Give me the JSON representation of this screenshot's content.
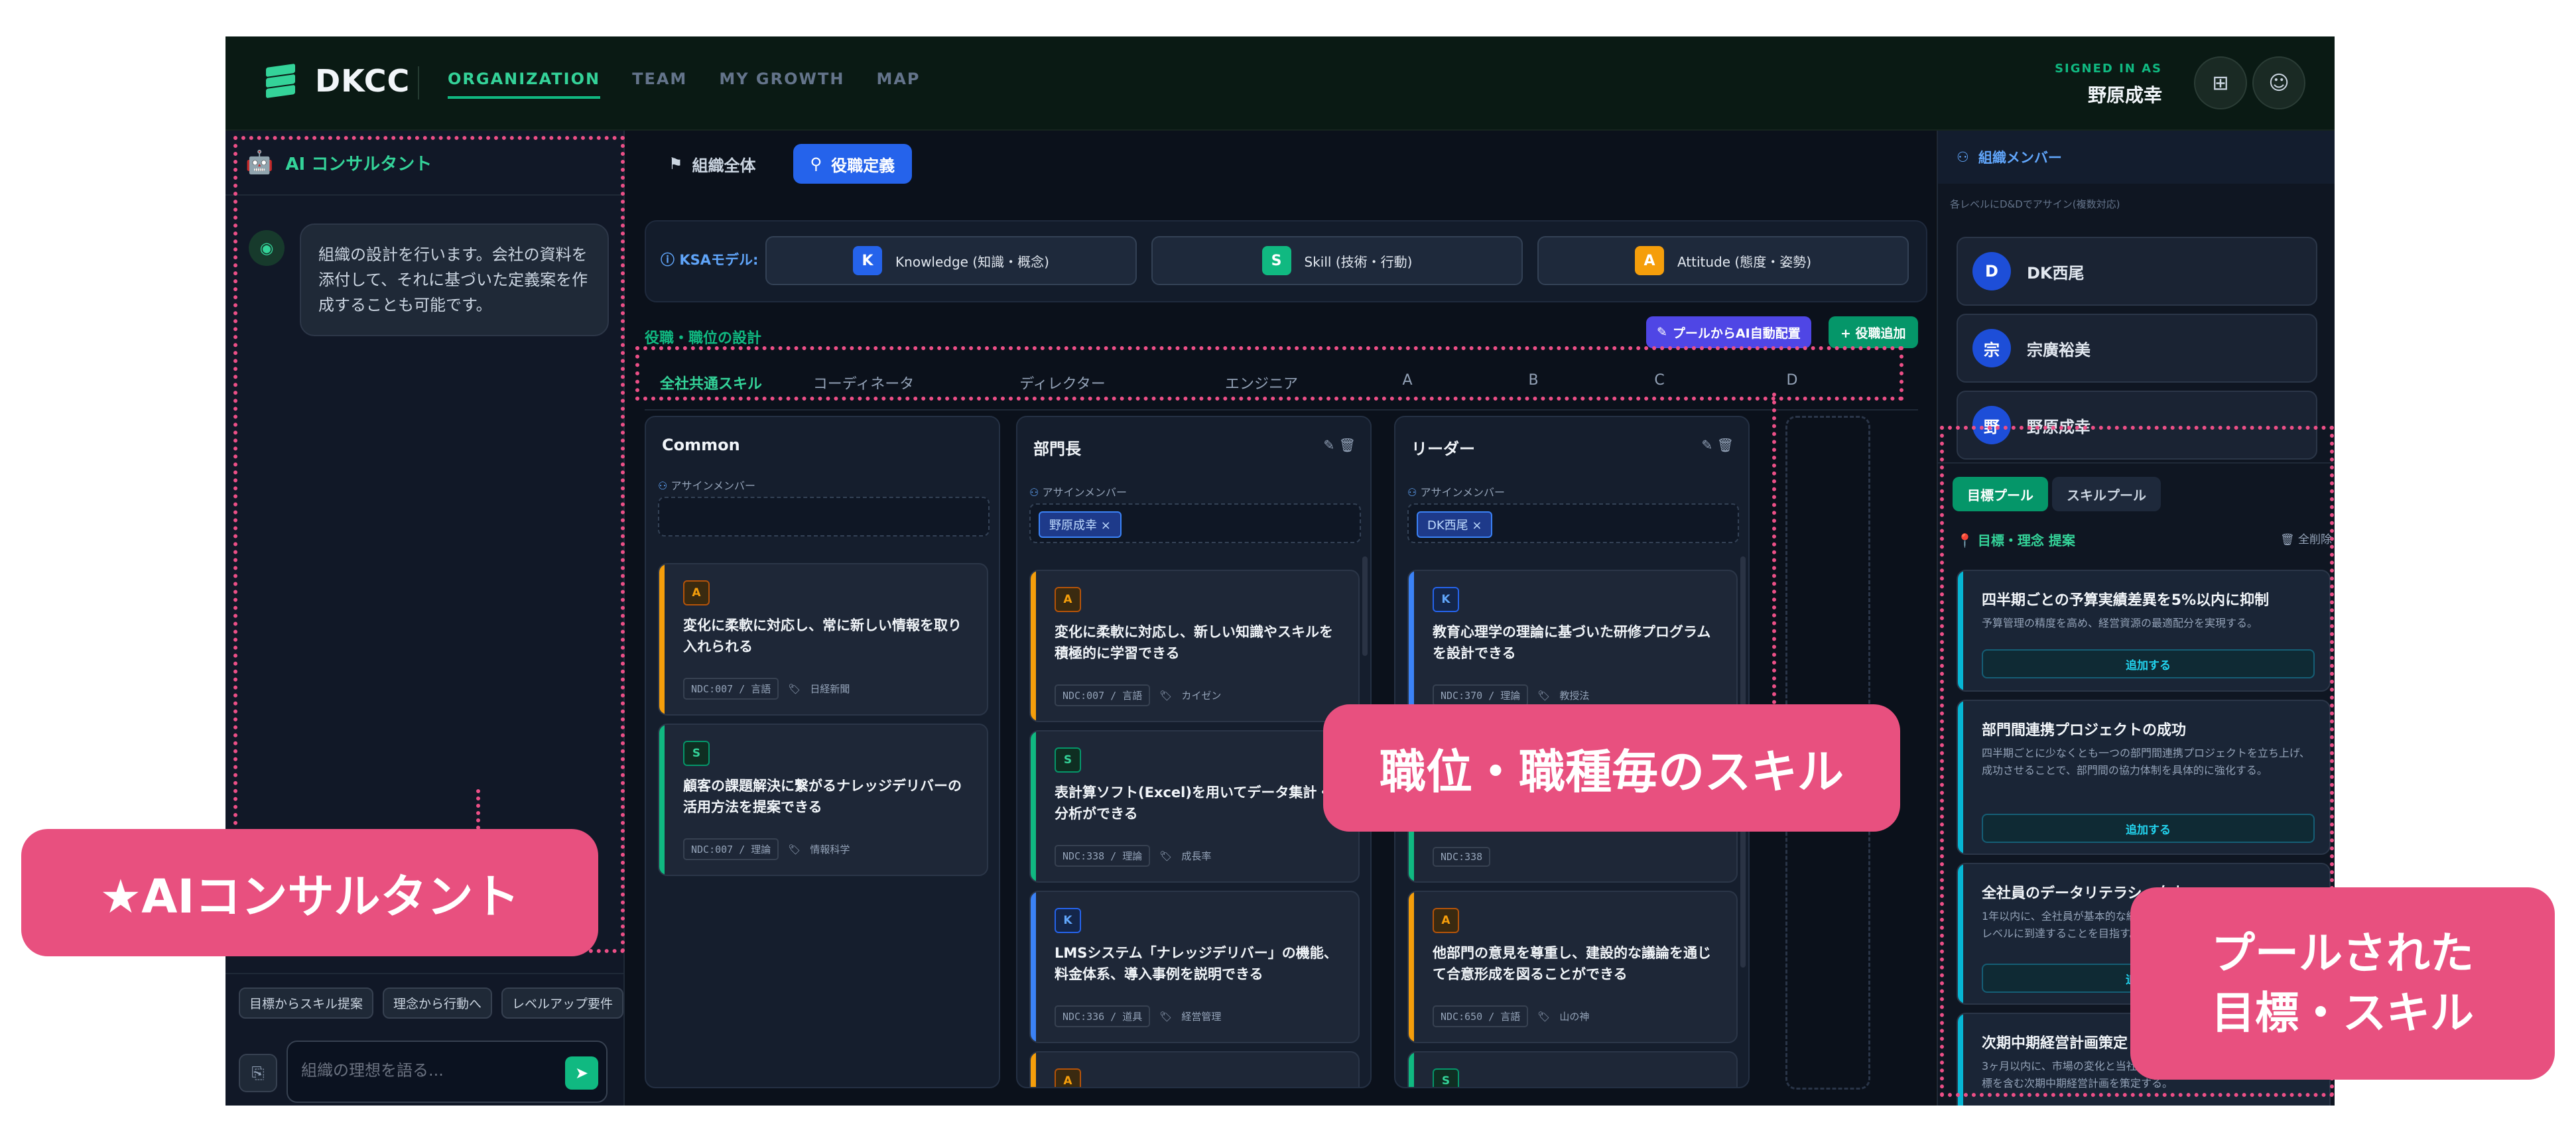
{
  "topbar": {
    "logo": "DKCC",
    "nav": [
      {
        "label": "ORGANIZATION",
        "active": true
      },
      {
        "label": "TEAM",
        "active": false
      },
      {
        "label": "MY GROWTH",
        "active": false
      },
      {
        "label": "MAP",
        "active": false
      }
    ],
    "signed_in_label": "SIGNED IN AS",
    "user_name": "野原成幸"
  },
  "chat": {
    "title": "AI コンサルタント",
    "message": "組織の設計を行います。会社の資料を添付して、それに基づいた定義案を作成することも可能です。",
    "chips": [
      "目標からスキル提案",
      "理念から行動へ",
      "レベルアップ要件"
    ],
    "input_placeholder": "組織の理想を語る..."
  },
  "center": {
    "tabs": [
      "組織全体",
      "役職定義"
    ],
    "ksa_label": "KSAモデル:",
    "ksa": [
      {
        "badge": "K",
        "label": "Knowledge (知識・概念)",
        "color": "#2563eb"
      },
      {
        "badge": "S",
        "label": "Skill (技術・行動)",
        "color": "#10b981"
      },
      {
        "badge": "A",
        "label": "Attitude (態度・姿勢)",
        "color": "#f59e0b"
      }
    ],
    "design_title": "役職・職位の設計",
    "auto_assign_button": "プールからAI自動配置",
    "add_role_button": "+ 役職追加",
    "role_tabs": [
      "全社共通スキル",
      "コーディネータ",
      "ディレクター",
      "エンジニア",
      "A",
      "B",
      "C",
      "D"
    ],
    "assign_label": "アサインメンバー",
    "columns": [
      {
        "title": "Common",
        "members": [],
        "cards": [
          {
            "type": "A",
            "text": "変化に柔軟に対応し、常に新しい情報を取り入れられる",
            "ndc": "NDC:007 / 言語",
            "src": "日経新聞"
          },
          {
            "type": "S",
            "text": "顧客の課題解決に繋がるナレッジデリバーの活用方法を提案できる",
            "ndc": "NDC:007 / 理論",
            "src": "情報科学"
          }
        ]
      },
      {
        "title": "部門長",
        "members": [
          "野原成幸 ×"
        ],
        "cards": [
          {
            "type": "A",
            "text": "変化に柔軟に対応し、新しい知識やスキルを積極的に学習できる",
            "ndc": "NDC:007 / 言語",
            "src": "カイゼン"
          },
          {
            "type": "S",
            "text": "表計算ソフト(Excel)を用いてデータ集計・分析ができる",
            "ndc": "NDC:338 / 理論",
            "src": "成長率"
          },
          {
            "type": "K",
            "text": "LMSシステム「ナレッジデリバー」の機能、料金体系、導入事例を説明できる",
            "ndc": "NDC:336 / 道具",
            "src": "経営管理"
          },
          {
            "type": "A",
            "text": "",
            "ndc": "",
            "src": ""
          }
        ]
      },
      {
        "title": "リーダー",
        "members": [
          "DK西尾 ×"
        ],
        "cards": [
          {
            "type": "K",
            "text": "教育心理学の理論に基づいた研修プログラムを設計できる",
            "ndc": "NDC:370 / 理論",
            "src": "教授法"
          },
          {
            "type": "S",
            "text": "",
            "ndc": "NDC:338",
            "src": ""
          },
          {
            "type": "A",
            "text": "他部門の意見を尊重し、建設的な議論を通じて合意形成を図ることができる",
            "ndc": "NDC:650 / 言語",
            "src": "山の神"
          },
          {
            "type": "S",
            "text": "",
            "ndc": "",
            "src": ""
          }
        ]
      }
    ]
  },
  "members": {
    "title": "組織メンバー",
    "subtitle": "各レベルにD&Dでアサイン(複数対応)",
    "list": [
      {
        "initial": "D",
        "name": "DK西尾"
      },
      {
        "initial": "宗",
        "name": "宗廣裕美"
      },
      {
        "initial": "野",
        "name": "野原成幸"
      }
    ]
  },
  "pool": {
    "tabs": [
      "目標プール",
      "スキルプール"
    ],
    "title": "目標・理念 提案",
    "all_label": "全削除",
    "add_label": "追加する",
    "goals": [
      {
        "title": "四半期ごとの予算実績差異を5%以内に抑制",
        "desc": "予算管理の精度を高め、経営資源の最適配分を実現する。"
      },
      {
        "title": "部門間連携プロジェクトの成功",
        "desc": "四半期ごとに少なくとも一つの部門間連携プロジェクトを立ち上げ、成功させることで、部門間の協力体制を具体的に強化する。"
      },
      {
        "title": "全社員のデータリテラシー向上",
        "desc": "1年以内に、全社員が基本的な統計分析を理解し、業務で活用できるレベルに到達することを目指す。"
      },
      {
        "title": "次期中期経営計画策定",
        "desc": "3ヶ月以内に、市場の変化と当社の強みを踏まえた、具体的な数値目標を含む次期中期経営計画を策定する。"
      }
    ]
  },
  "annotations": {
    "ai": "★AIコンサルタント",
    "skills": "職位・職種毎のスキル",
    "pool": [
      "プールされた",
      "目標・スキル"
    ]
  }
}
